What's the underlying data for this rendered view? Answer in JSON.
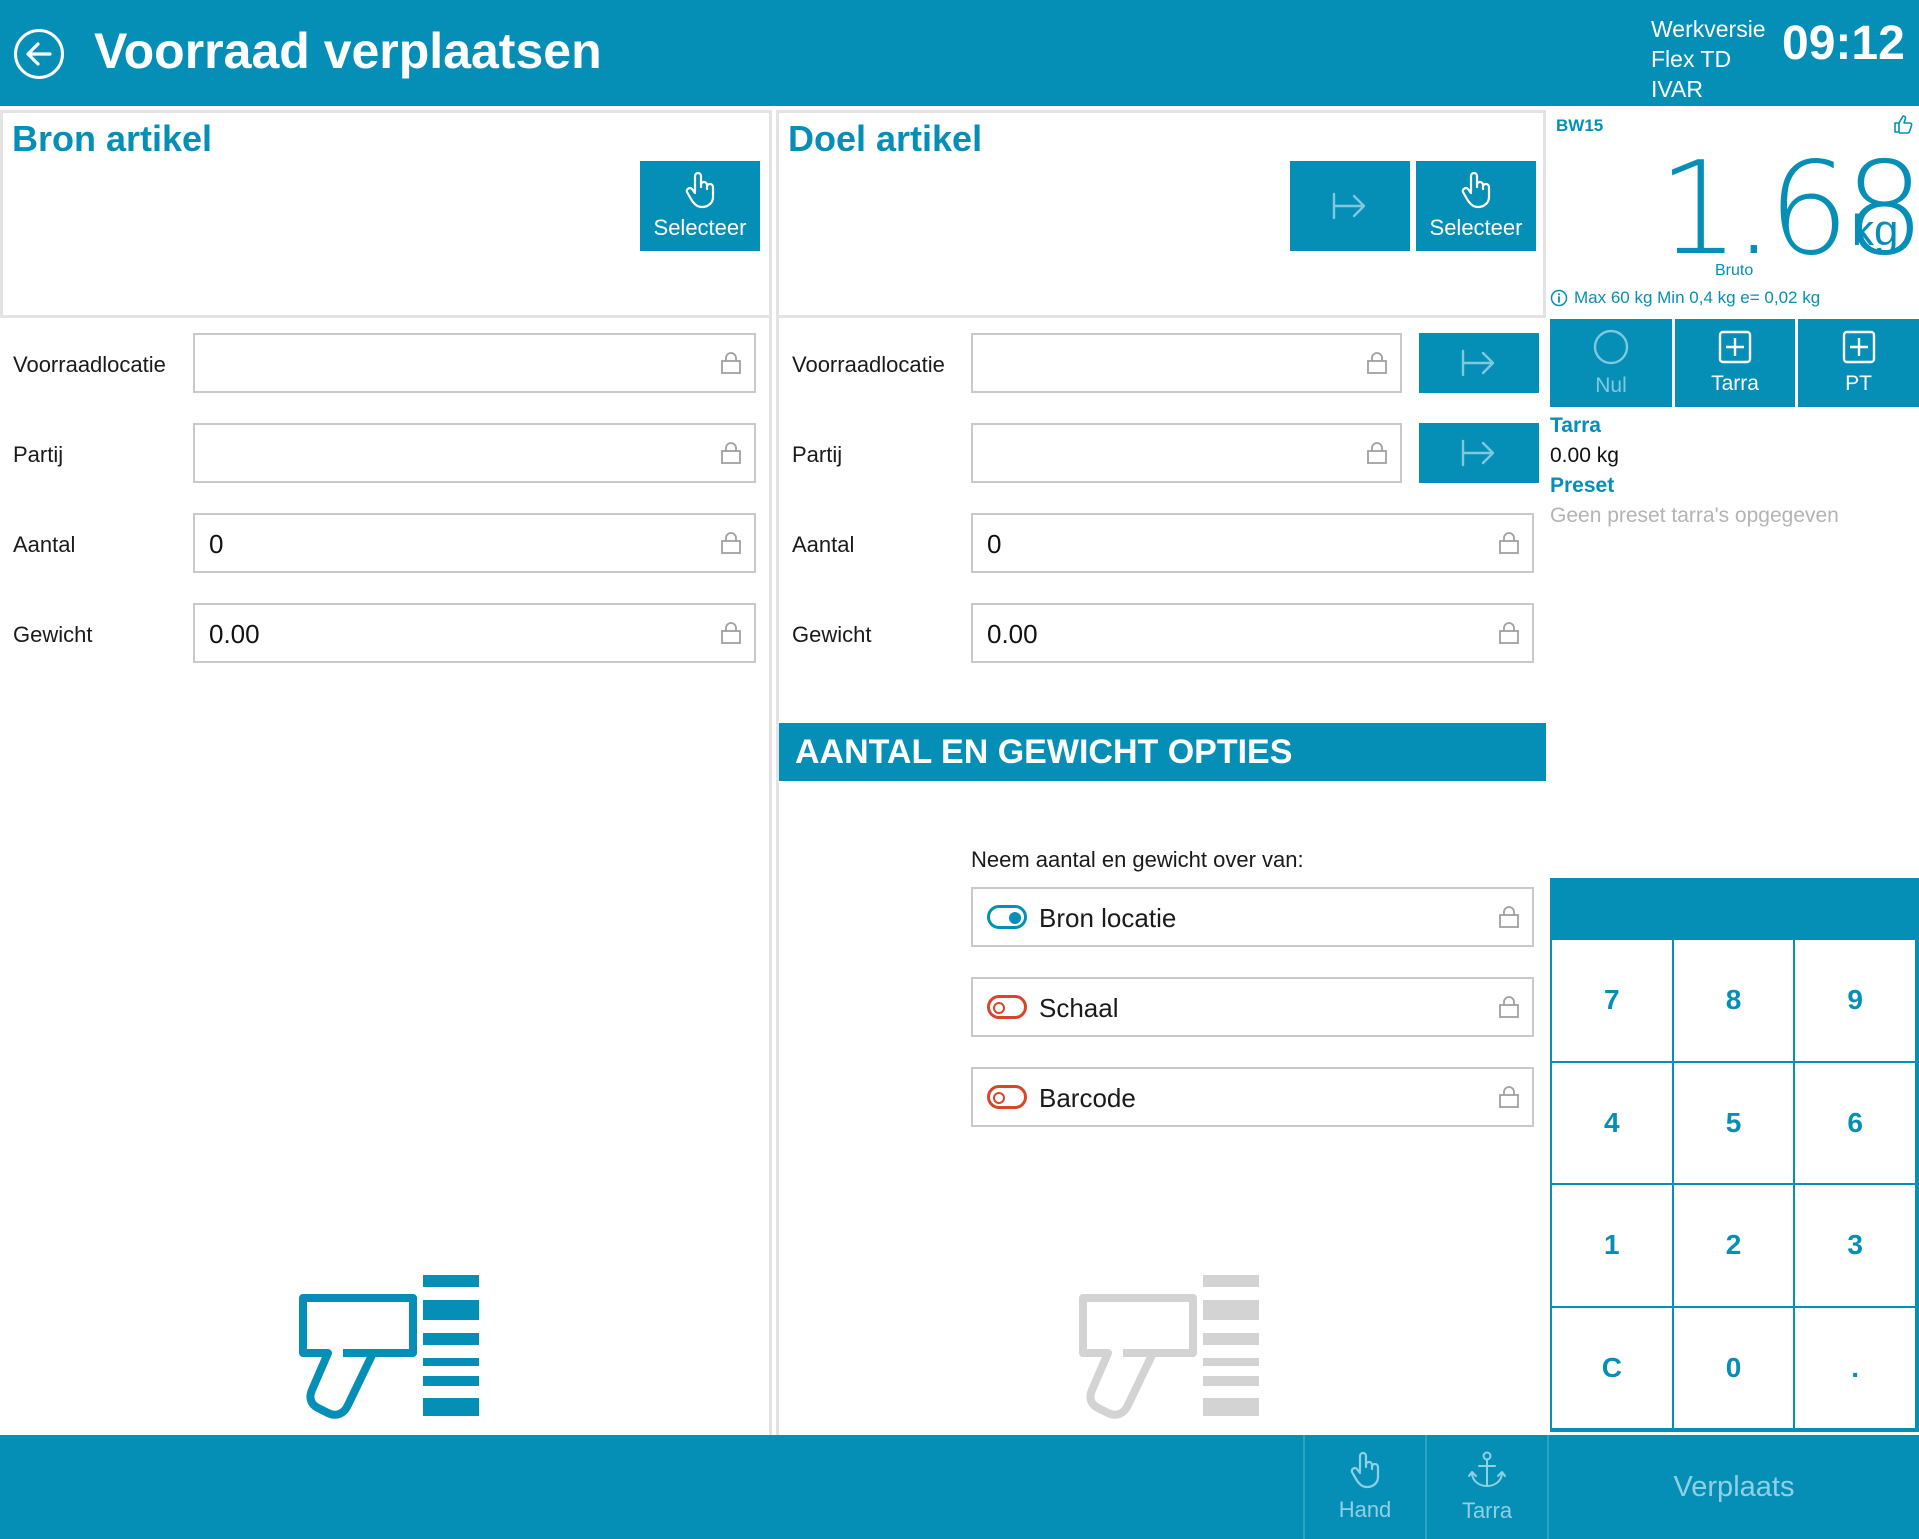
{
  "header": {
    "title": "Voorraad verplaatsen",
    "info_line1": "Werkversie",
    "info_line2": "Flex TD",
    "info_line3": "IVAR",
    "clock": "09:12"
  },
  "source": {
    "title": "Bron artikel",
    "select_label": "Selecteer",
    "fields": [
      {
        "label": "Voorraadlocatie",
        "value": ""
      },
      {
        "label": "Partij",
        "value": ""
      },
      {
        "label": "Aantal",
        "value": "0"
      },
      {
        "label": "Gewicht",
        "value": "0.00"
      }
    ]
  },
  "target": {
    "title": "Doel artikel",
    "select_label": "Selecteer",
    "fields": [
      {
        "label": "Voorraadlocatie",
        "value": ""
      },
      {
        "label": "Partij",
        "value": ""
      },
      {
        "label": "Aantal",
        "value": "0"
      },
      {
        "label": "Gewicht",
        "value": "0.00"
      }
    ],
    "options_title": "AANTAL EN GEWICHT OPTIES",
    "options_prompt": "Neem aantal en gewicht over van:",
    "options": [
      {
        "label": "Bron locatie",
        "state": "on"
      },
      {
        "label": "Schaal",
        "state": "off"
      },
      {
        "label": "Barcode",
        "state": "off"
      }
    ]
  },
  "scale": {
    "name": "BW15",
    "value": "1.68",
    "unit": "kg",
    "mode": "Bruto",
    "info": "Max 60 kg Min 0,4 kg e= 0,02 kg",
    "buttons": {
      "zero": "Nul",
      "tare": "Tarra",
      "preset_tare": "PT"
    },
    "tare_title": "Tarra",
    "tare_value": "0.00 kg",
    "preset_title": "Preset",
    "preset_empty": "Geen preset tarra's opgegeven"
  },
  "keypad": {
    "keys": [
      "7",
      "8",
      "9",
      "4",
      "5",
      "6",
      "1",
      "2",
      "3",
      "C",
      "0",
      "."
    ]
  },
  "footer": {
    "hand_label": "Hand",
    "tare_label": "Tarra",
    "move_label": "Verplaats"
  },
  "colors": {
    "accent": "#058fb7",
    "toggle_off": "#d9452b",
    "disabled": "#d3d3d3"
  }
}
